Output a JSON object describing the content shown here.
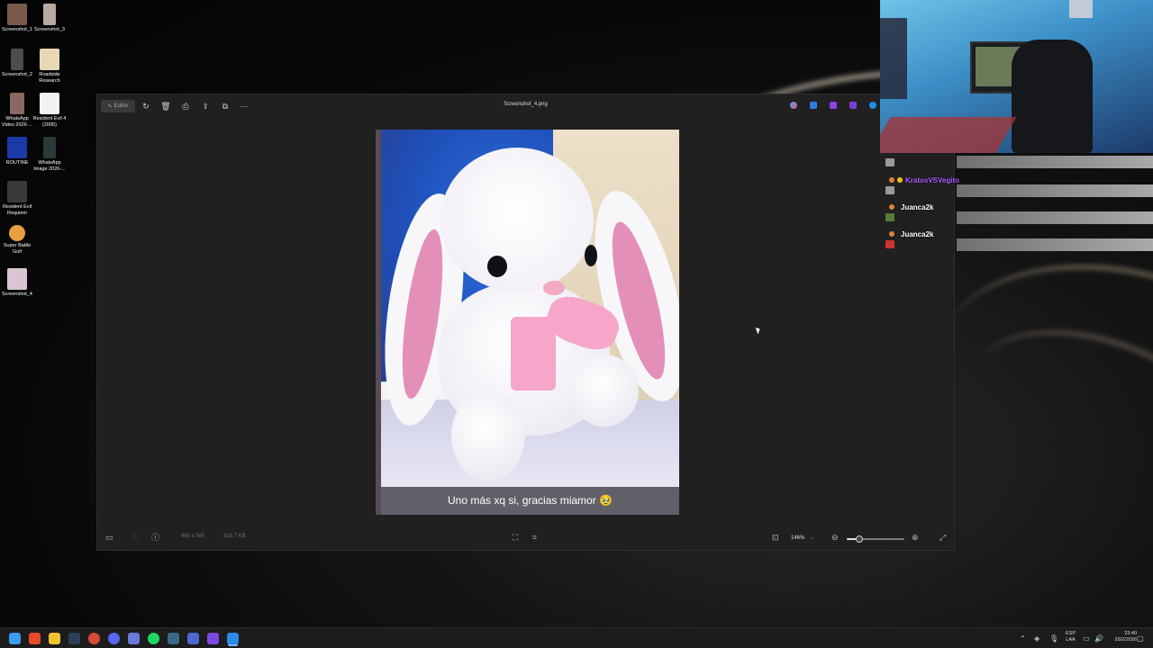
{
  "desktop": {
    "icons": [
      {
        "label": "Screenshot_1"
      },
      {
        "label": "Screenshot_3"
      },
      {
        "label": "Screenshot_2"
      },
      {
        "label": "Roadside Research"
      },
      {
        "label": "WhatsApp Video 2026-..."
      },
      {
        "label": "Resident Evil 4 (2005)"
      },
      {
        "label": "ROUTINE"
      },
      {
        "label": "WhatsApp Image 2026-..."
      },
      {
        "label": "Resident Evil Requiem"
      },
      {
        "label": "Super Battle Golf"
      },
      {
        "label": "Screenshot_4"
      }
    ]
  },
  "viewer": {
    "title": "Screenshot_4.png",
    "editor_label": "Editor",
    "toolbar_icons": [
      "rotate-icon",
      "delete-icon",
      "print-icon",
      "share-icon",
      "copy-icon",
      "more-icon"
    ],
    "caption": "Uno más xq si, gracias miamor 🥹",
    "dimensions": "460 x 585",
    "file_size": "318.7 KB",
    "zoom": "146%",
    "zoom_level": 0.22
  },
  "chat": {
    "messages": [
      {
        "user": "KratosVSVegito",
        "color": "#b05cff"
      },
      {
        "user": "Juanca2k",
        "color": "#ffffff"
      },
      {
        "user": "Juanca2k",
        "color": "#ffffff"
      }
    ]
  },
  "taskbar": {
    "lang_top": "ESP",
    "lang_bottom": "LAA",
    "time": "23:40",
    "date": "26/2/2026"
  }
}
